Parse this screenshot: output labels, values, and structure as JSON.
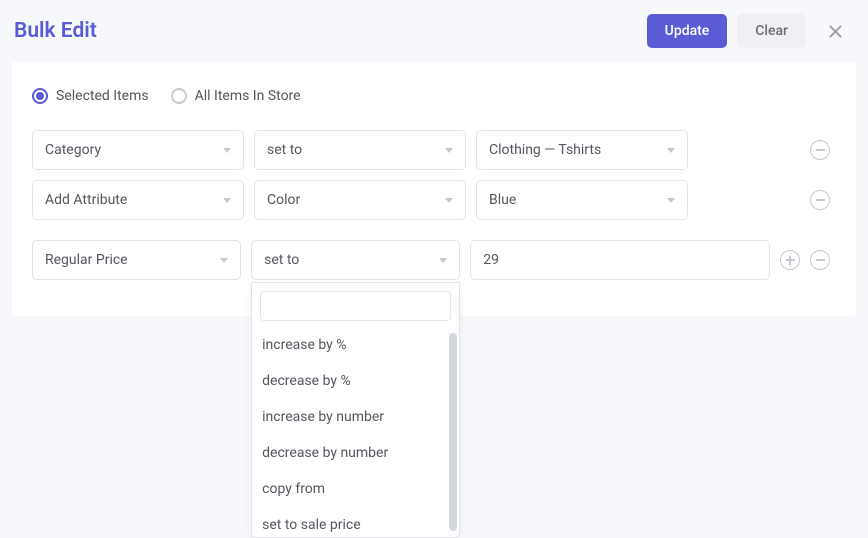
{
  "header": {
    "title": "Bulk Edit",
    "update": "Update",
    "clear": "Clear"
  },
  "scope": {
    "selected": "Selected Items",
    "all": "All Items In Store"
  },
  "rows": [
    {
      "field": "Category",
      "op": "set to",
      "value": "Clothing — Tshirts"
    },
    {
      "field": "Add Attribute",
      "op": "Color",
      "value": "Blue"
    },
    {
      "field": "Regular Price",
      "op": "set to",
      "value": "29"
    }
  ],
  "dropdown": {
    "options": [
      "increase by %",
      "decrease by %",
      "increase by number",
      "decrease by number",
      "copy from",
      "set to sale price"
    ]
  }
}
